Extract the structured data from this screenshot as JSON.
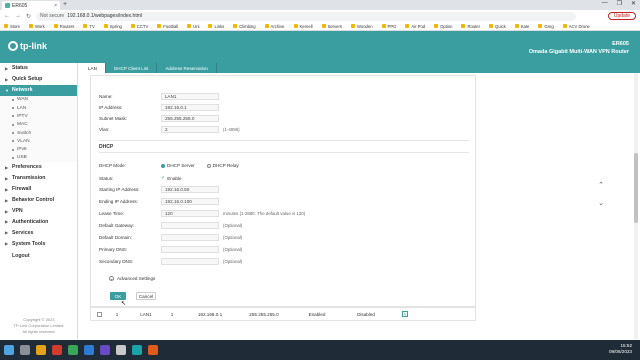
{
  "browser": {
    "tab_title": "ER605",
    "tab_close": "×",
    "new_tab": "+",
    "window_controls": [
      "—",
      "❐",
      "✕"
    ],
    "address": {
      "security": "Not secure",
      "url": "192.168.0.1/webpages/index.html"
    },
    "update_label": "Update"
  },
  "bookmarks": [
    "Store",
    "Work",
    "Routers",
    "TV",
    "Spring",
    "CCTV",
    "Football",
    "Uni",
    "Links",
    "Climbing",
    "Archive",
    "Kernell",
    "Servers",
    "Wooden",
    "PPG",
    "Air Pod",
    "Option",
    "Router",
    "Quick",
    "Kate",
    "Greg",
    "ACV Drone"
  ],
  "header": {
    "brand": "tp-link",
    "model": "ER605",
    "subtitle": "Omada Gigabit Multi-WAN VPN Router"
  },
  "sidebar": {
    "items": [
      {
        "label": "Status",
        "active": false
      },
      {
        "label": "Quick Setup",
        "active": false
      },
      {
        "label": "Network",
        "active": true
      }
    ],
    "network_sub": [
      "WAN",
      "LAN",
      "IPTV",
      "MAC",
      "Switch",
      "VLAN",
      "IPv6",
      "USB"
    ],
    "items_after": [
      "Preferences",
      "Transmission",
      "Firewall",
      "Behavior Control",
      "VPN",
      "Authentication",
      "Services",
      "System Tools"
    ],
    "logout": "Logout",
    "copyright": [
      "Copyright © 2023",
      "TP-Link Corporation Limited.",
      "All rights reserved."
    ]
  },
  "subtabs": [
    "LAN",
    "DHCP Client List",
    "Address Reservation"
  ],
  "form": {
    "name": {
      "label": "Name:",
      "value": "LAN1"
    },
    "ip": {
      "label": "IP Address:",
      "value": "192.16.0.1"
    },
    "mask": {
      "label": "Subnet Mask:",
      "value": "255.255.255.0"
    },
    "vlan": {
      "label": "Vlan:",
      "value": "2",
      "hint": "(1-4086)"
    },
    "dhcp_title": "DHCP",
    "dhcp_mode": {
      "label": "DHCP Mode:",
      "opt1": "DHCP Server",
      "opt2": "DHCP Relay"
    },
    "status": {
      "label": "Status:",
      "value": "Enable"
    },
    "start_ip": {
      "label": "Starting IP Address:",
      "value": "192.16.0.50"
    },
    "end_ip": {
      "label": "Ending IP Address:",
      "value": "192.16.0.100"
    },
    "lease": {
      "label": "Lease Time:",
      "value": "120",
      "hint": "minutes (1-2880. The default value is 120)"
    },
    "gateway": {
      "label": "Default Gateway:",
      "hint": "(Optional)"
    },
    "domain": {
      "label": "Default Domain:",
      "hint": "(Optional)"
    },
    "dns1": {
      "label": "Primary DNS:",
      "hint": "(Optional)"
    },
    "dns2": {
      "label": "Secondary DNS:",
      "hint": "(Optional)"
    },
    "advanced": "Advanced Settings",
    "ok": "OK",
    "cancel": "Cancel"
  },
  "table_row": {
    "index": "1",
    "name": "LAN1",
    "vlan": "1",
    "ip": "192.168.0.1",
    "mask": "255.255.255.0",
    "status": "Enabled",
    "dhcp": "Disabled"
  },
  "clock": {
    "time": "15:52",
    "date": "09/06/2023"
  },
  "colors": {
    "accent": "#3a9ea0",
    "taskbar": "#1f2b36"
  }
}
